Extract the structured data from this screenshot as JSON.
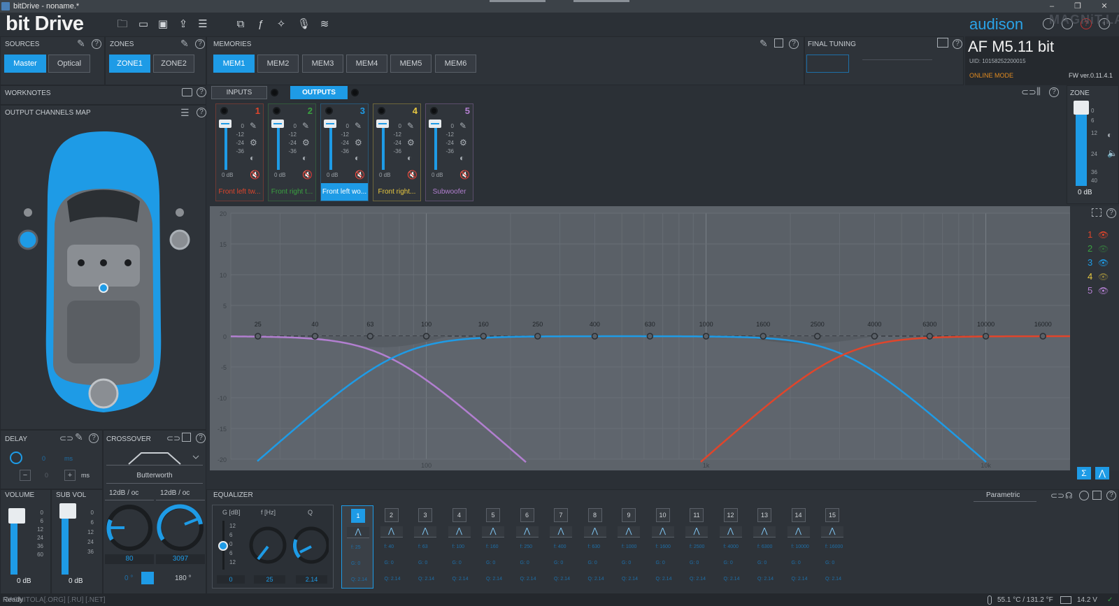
{
  "window": {
    "title": "bitDrive - noname.*",
    "controls": [
      "–",
      "❐",
      "✕"
    ]
  },
  "app": {
    "logo": "bit Drive",
    "brand": "audison",
    "watermark": "MAGNiT.LA",
    "device": "AF M5.11 bit",
    "uid": "UID: 10158252200015",
    "mode": "ONLINE MODE",
    "fw": "FW ver.0.11.4.1"
  },
  "sources": {
    "title": "SOURCES",
    "buttons": [
      "Master",
      "Optical"
    ],
    "selected": 0
  },
  "zones": {
    "title": "ZONES",
    "buttons": [
      "ZONE1",
      "ZONE2"
    ],
    "selected": 0
  },
  "memories": {
    "title": "MEMORIES",
    "buttons": [
      "MEM1",
      "MEM2",
      "MEM3",
      "MEM4",
      "MEM5",
      "MEM6"
    ],
    "selected": 0
  },
  "final_tuning": {
    "title": "FINAL TUNING"
  },
  "worknotes": {
    "title": "WORKNOTES"
  },
  "io_tabs": {
    "inputs": "INPUTS",
    "outputs": "OUTPUTS",
    "selected": "outputs"
  },
  "channel_map": {
    "title": "OUTPUT CHANNELS MAP"
  },
  "strips": [
    {
      "num": "1",
      "label": "Front left tw...",
      "color": "#e0452b",
      "scale": [
        "0",
        "-12",
        "-24",
        "-36"
      ],
      "db": "0 dB"
    },
    {
      "num": "2",
      "label": "Front right t...",
      "color": "#3aa040",
      "scale": [
        "0",
        "-12",
        "-24",
        "-36"
      ],
      "db": "0 dB"
    },
    {
      "num": "3",
      "label": "Front left wo...",
      "color": "#1e9be6",
      "scale": [
        "0",
        "-12",
        "-24",
        "-36"
      ],
      "db": "0 dB"
    },
    {
      "num": "4",
      "label": "Front right...",
      "color": "#e8c840",
      "scale": [
        "0",
        "-12",
        "-24",
        "-36"
      ],
      "db": "0 dB"
    },
    {
      "num": "5",
      "label": "Subwoofer",
      "color": "#b27fd0",
      "scale": [
        "0",
        "-12",
        "-24",
        "-36"
      ],
      "db": "0 dB"
    }
  ],
  "zone_panel": {
    "title": "ZONE",
    "scale": [
      "0",
      "6",
      "12",
      "24",
      "36",
      "40"
    ],
    "db": "0 dB"
  },
  "graph": {
    "freq_labels": [
      "25",
      "40",
      "63",
      "100",
      "160",
      "250",
      "400",
      "630",
      "1000",
      "1600",
      "2500",
      "4000",
      "6300",
      "10000",
      "16000"
    ],
    "y_labels": [
      "20",
      "15",
      "10",
      "5",
      "0",
      "-5",
      "-10",
      "-15",
      "-20"
    ],
    "decade_labels": [
      "100",
      "1k",
      "10k"
    ],
    "legend": [
      "1",
      "2",
      "3",
      "4",
      "5"
    ]
  },
  "delay": {
    "title": "DELAY",
    "value": "0",
    "unit": "ms",
    "step_value": "0",
    "step_unit": "ms",
    "minus": "−",
    "plus": "+"
  },
  "crossover": {
    "title": "CROSSOVER",
    "type": "Butterworth",
    "slope_left": "12dB / oc",
    "slope_right": "12dB / oc",
    "freq_left": "80",
    "freq_right": "3097",
    "phase_left": "0 °",
    "phase_right": "180 °"
  },
  "volume": {
    "title": "VOLUME",
    "scale": [
      "0",
      "6",
      "12",
      "24",
      "36",
      "60"
    ],
    "db": "0 dB"
  },
  "sub_vol": {
    "title": "SUB VOL",
    "scale": [
      "0",
      "6",
      "12",
      "24",
      "36"
    ],
    "db": "0 dB"
  },
  "equalizer": {
    "title": "EQUALIZER",
    "mode": "Parametric",
    "g_label": "G [dB]",
    "f_label": "f [Hz]",
    "q_label": "Q",
    "g_scale": [
      "12",
      "6",
      "0",
      "6",
      "12"
    ],
    "g_value": "0",
    "f_value": "25",
    "q_value": "2.14",
    "bands": [
      {
        "n": "1",
        "f": "f: 25",
        "g": "G: 0",
        "q": "Q: 2.14"
      },
      {
        "n": "2",
        "f": "f: 40",
        "g": "G: 0",
        "q": "Q: 2.14"
      },
      {
        "n": "3",
        "f": "f: 63",
        "g": "G: 0",
        "q": "Q: 2.14"
      },
      {
        "n": "4",
        "f": "f: 100",
        "g": "G: 0",
        "q": "Q: 2.14"
      },
      {
        "n": "5",
        "f": "f: 160",
        "g": "G: 0",
        "q": "Q: 2.14"
      },
      {
        "n": "6",
        "f": "f: 250",
        "g": "G: 0",
        "q": "Q: 2.14"
      },
      {
        "n": "7",
        "f": "f: 400",
        "g": "G: 0",
        "q": "Q: 2.14"
      },
      {
        "n": "8",
        "f": "f: 630",
        "g": "G: 0",
        "q": "Q: 2.14"
      },
      {
        "n": "9",
        "f": "f: 1000",
        "g": "G: 0",
        "q": "Q: 2.14"
      },
      {
        "n": "10",
        "f": "f: 1600",
        "g": "G: 0",
        "q": "Q: 2.14"
      },
      {
        "n": "11",
        "f": "f: 2500",
        "g": "G: 0",
        "q": "Q: 2.14"
      },
      {
        "n": "12",
        "f": "f: 4000",
        "g": "G: 0",
        "q": "Q: 2.14"
      },
      {
        "n": "13",
        "f": "f: 6300",
        "g": "G: 0",
        "q": "Q: 2.14"
      },
      {
        "n": "14",
        "f": "f: 10000",
        "g": "G: 0",
        "q": "Q: 2.14"
      },
      {
        "n": "15",
        "f": "f: 16000",
        "g": "G: 0",
        "q": "Q: 2.14"
      }
    ]
  },
  "status": {
    "left": "Ready",
    "watermark": "MAGNITOLA[.ORG] [.RU] [.NET]",
    "temp": "55.1 °C / 131.2 °F",
    "voltage": "14.2 V"
  },
  "colors": {
    "accent": "#1e9be6",
    "ch1": "#e0452b",
    "ch2": "#3aa040",
    "ch3": "#1e9be6",
    "ch4": "#e8c840",
    "ch5": "#b27fd0",
    "car": "#1e9be6"
  }
}
